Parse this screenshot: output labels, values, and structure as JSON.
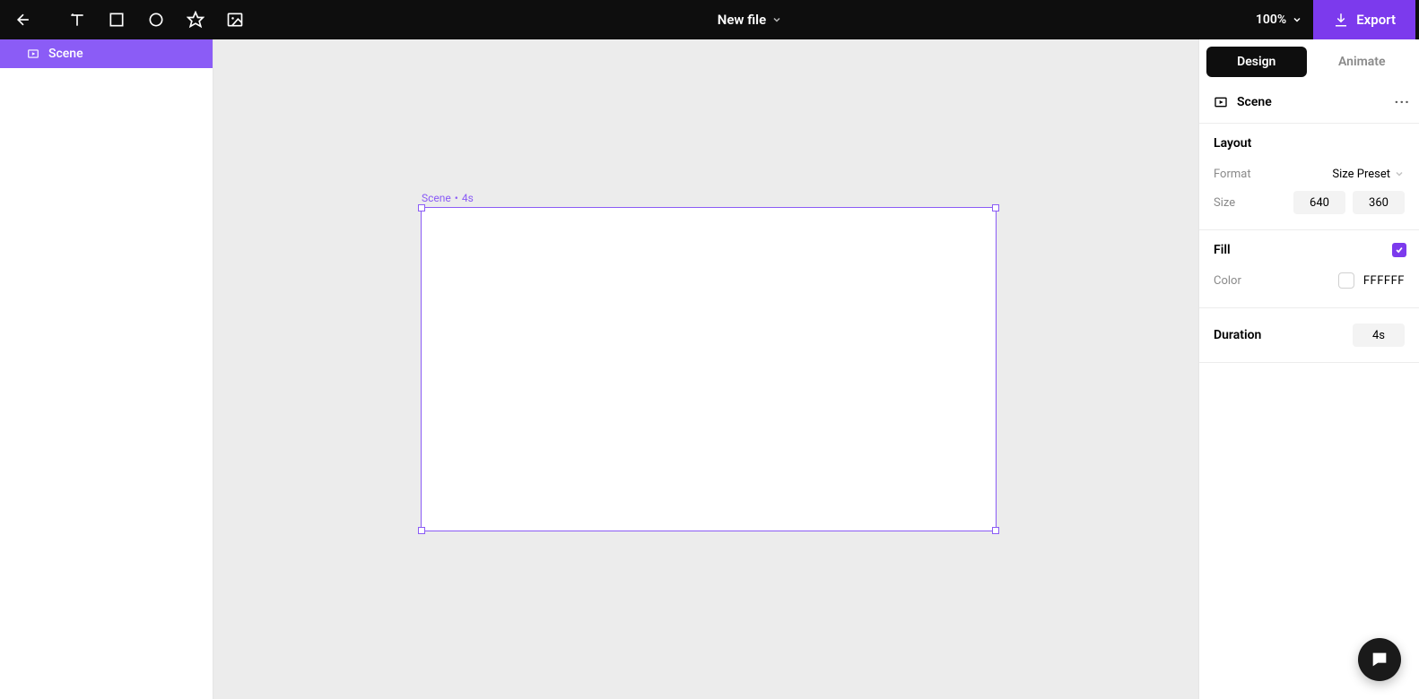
{
  "topbar": {
    "title": "New file",
    "zoom": "100%",
    "export_label": "Export"
  },
  "left": {
    "scene_label": "Scene"
  },
  "canvas": {
    "scene_name": "Scene",
    "scene_duration": "4s"
  },
  "right": {
    "tabs": {
      "design": "Design",
      "animate": "Animate"
    },
    "scene_label": "Scene",
    "layout": {
      "title": "Layout",
      "format_label": "Format",
      "format_value": "Size Preset",
      "size_label": "Size",
      "width": "640",
      "height": "360"
    },
    "fill": {
      "title": "Fill",
      "color_label": "Color",
      "color_value": "FFFFFF"
    },
    "duration": {
      "title": "Duration",
      "value": "4s"
    }
  }
}
